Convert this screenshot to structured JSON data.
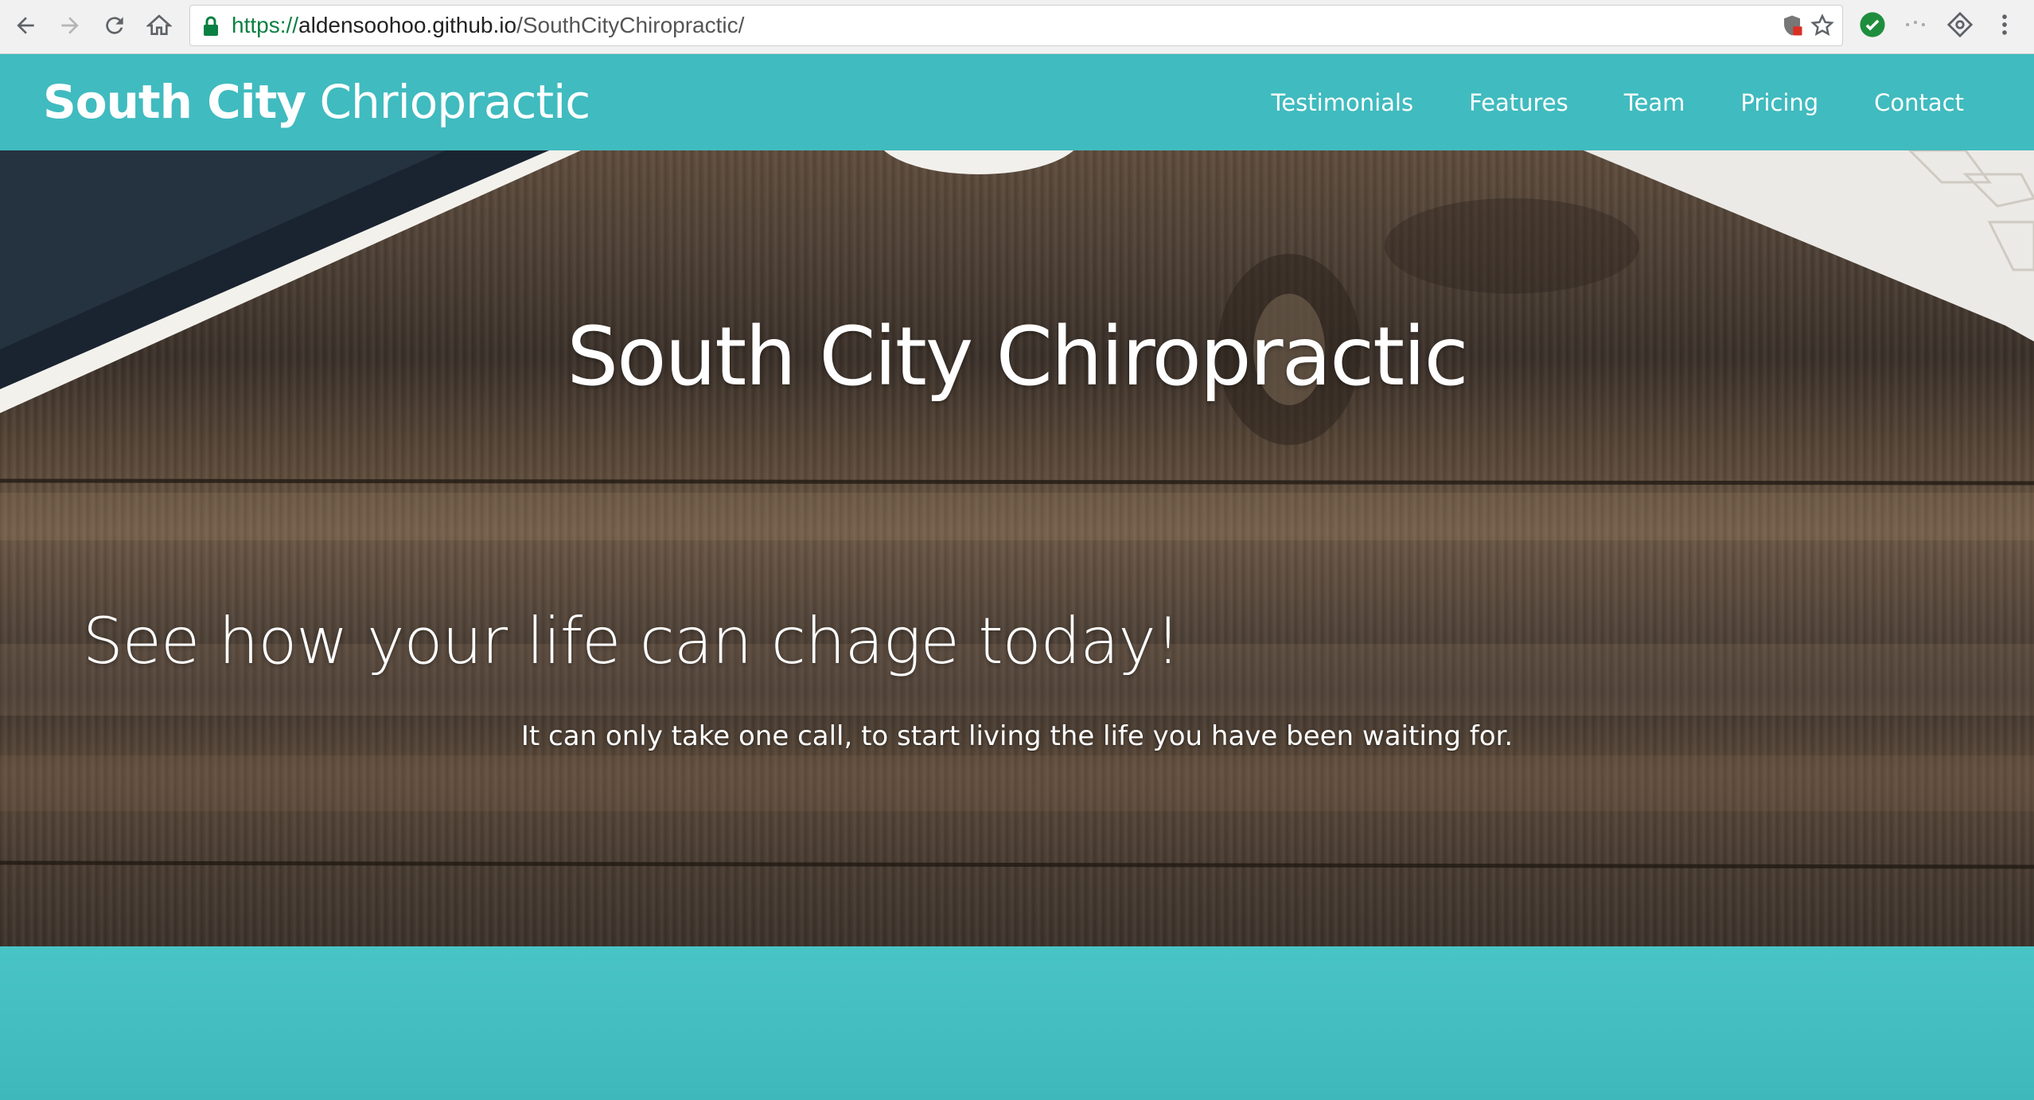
{
  "browser": {
    "url_scheme": "https://",
    "url_host": "aldensoohoo.github.io",
    "url_path": "/SouthCityChiropractic/",
    "icons": [
      "back-icon",
      "forward-icon",
      "reload-icon",
      "home-icon",
      "lock-icon",
      "shield-icon",
      "star-icon",
      "extension-check-icon",
      "extension-dots-icon",
      "extension-puzzle-icon",
      "menu-icon"
    ]
  },
  "navbar": {
    "brand_bold": "South City",
    "brand_light": "Chriopractic",
    "links": [
      "Testimonials",
      "Features",
      "Team",
      "Pricing",
      "Contact"
    ],
    "background_color": "#40bbbf"
  },
  "hero": {
    "title": "South City Chiropractic",
    "subtitle": "See how your life can chage today!",
    "text": "It can only take one call, to start living the life you have been waiting for."
  },
  "section2": {
    "background_color": "#45c0c3"
  }
}
